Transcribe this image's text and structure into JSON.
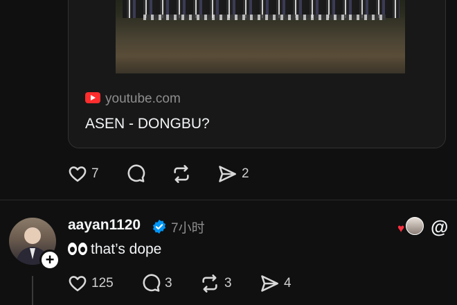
{
  "link_card": {
    "domain": "youtube.com",
    "title": "ASEN - DONGBU?"
  },
  "post_actions": {
    "likes": "7",
    "reposts_label": "",
    "shares": "2"
  },
  "reply": {
    "username": "aayan1120",
    "time": "7小时",
    "text": "that’s dope",
    "likes": "125",
    "comments": "3",
    "reposts": "3",
    "shares": "4"
  },
  "colors": {
    "background": "#101010",
    "verified": "#0095f6",
    "youtube": "#ff2d2d",
    "heart": "#ff3040"
  },
  "icons": [
    "heart-icon",
    "comment-icon",
    "repost-icon",
    "share-icon",
    "verified-icon",
    "youtube-icon",
    "threads-icon",
    "plus-icon"
  ]
}
